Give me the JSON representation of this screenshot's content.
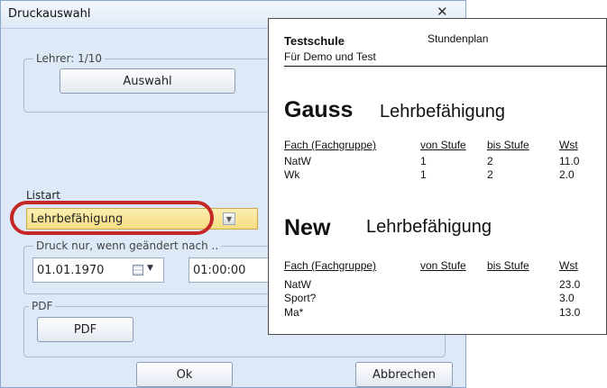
{
  "dialog": {
    "title": "Druckauswahl",
    "close_glyph": "✕",
    "teacher_group_label": "Lehrer: 1/10",
    "select_button": "Auswahl",
    "list_type_label": "Listart",
    "list_type_value": "Lehrbefähigung",
    "print_if_changed_label": "Druck nur, wenn geändert nach ..",
    "date_value": "01.01.1970",
    "time_value": "01:00:00",
    "pdf_group_label": "PDF",
    "pdf_button": "PDF",
    "ok_button": "Ok",
    "cancel_button": "Abbrechen",
    "highlight_color": "#c52626"
  },
  "preview": {
    "school": "Testschule",
    "doc_type": "Stundenplan",
    "subtitle": "Für Demo und Test",
    "sections": [
      {
        "teacher": "Gauss",
        "heading": "Lehrbefähigung",
        "headers": [
          "Fach (Fachgruppe)",
          "von Stufe",
          "bis Stufe",
          "Wst"
        ],
        "rows": [
          [
            "NatW",
            "1",
            "2",
            "11.0"
          ],
          [
            "Wk",
            "1",
            "2",
            "2.0"
          ]
        ]
      },
      {
        "teacher": "New",
        "heading": "Lehrbefähigung",
        "headers": [
          "Fach (Fachgruppe)",
          "von Stufe",
          "bis Stufe",
          "Wst"
        ],
        "rows": [
          [
            "NatW",
            "",
            "",
            "23.0"
          ],
          [
            "Sport?",
            "",
            "",
            "3.0"
          ],
          [
            "Ma*",
            "",
            "",
            "13.0"
          ]
        ]
      }
    ]
  }
}
